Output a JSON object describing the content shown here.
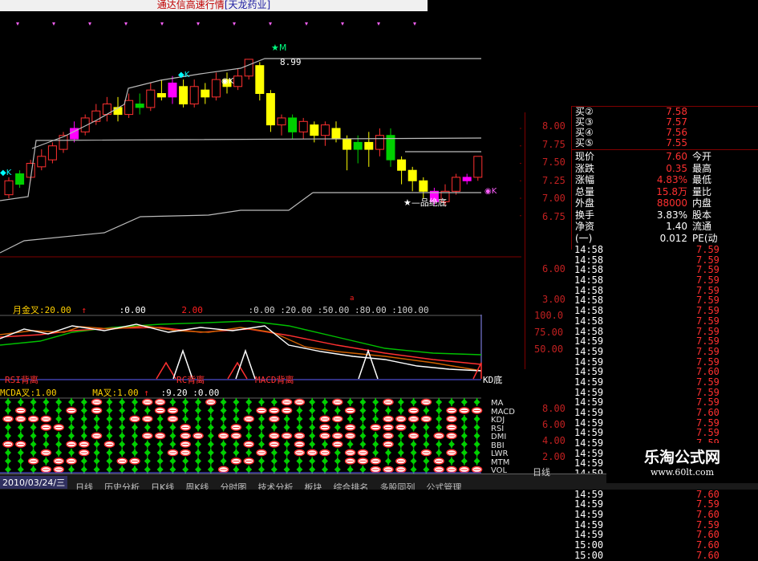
{
  "title": {
    "text": "通达信高速行情",
    "tag": "[天龙药业]"
  },
  "price_axis": {
    "ticks": [
      "8.00",
      "7.75",
      "7.50",
      "7.25",
      "7.00",
      "6.75"
    ]
  },
  "vol_axis": {
    "ticks": [
      "6.00",
      "3.00"
    ]
  },
  "kdj_axis": {
    "ticks": [
      "100.0",
      "75.00",
      "50.00"
    ]
  },
  "sig_axis": {
    "ticks": [
      "8.00",
      "6.00",
      "4.00",
      "2.00"
    ]
  },
  "chart_labels": {
    "high": "8.99",
    "m_marker": "M",
    "k_marker": "K",
    "k_marker2": "K",
    "bottom_text": "品绝底"
  },
  "kdj_header": {
    "indicator": "月金叉:20.00",
    "v1": ":0.00",
    "v2": "2.00",
    "v3": ":0.00 :20.00 :50.00 :80.00 :100.00",
    "mark": "a"
  },
  "sig_header": {
    "left": "MCDA叉:1.00",
    "mid": "MA叉:1.00",
    "right": ":9.20 :0.00"
  },
  "sig_small_labels": {
    "rsi": "RSI背离",
    "rc": "RC背离",
    "macd": "MACD背离",
    "kd": "KD底"
  },
  "indicators": [
    "MA",
    "MACD",
    "KDJ",
    "RSI",
    "DMI",
    "BBI",
    "LWR",
    "MTM",
    "VOL"
  ],
  "quote": {
    "top_rows": [
      {
        "label": "买②",
        "value": "7.58"
      },
      {
        "label": "买③",
        "value": "7.57"
      },
      {
        "label": "买④",
        "value": "7.56"
      },
      {
        "label": "买⑤",
        "value": "7.55"
      }
    ],
    "stats": [
      {
        "label": "现价",
        "value": "7.60",
        "right": "今开"
      },
      {
        "label": "涨跌",
        "value": "0.35",
        "right": "最高"
      },
      {
        "label": "涨幅",
        "value": "4.83%",
        "right": "最低"
      },
      {
        "label": "总量",
        "value": "15.8万",
        "right": "量比"
      },
      {
        "label": "外盘",
        "value": "88000",
        "right": "内盘"
      },
      {
        "label": "换手",
        "value": "3.83%",
        "right": "股本"
      },
      {
        "label": "净资",
        "value": "1.40",
        "right": "流通"
      },
      {
        "label": "(一)",
        "value": "0.012",
        "right": "PE(动"
      }
    ],
    "ticks": [
      {
        "time": "14:58",
        "price": "7.59"
      },
      {
        "time": "14:58",
        "price": "7.59"
      },
      {
        "time": "14:58",
        "price": "7.59"
      },
      {
        "time": "14:58",
        "price": "7.59"
      },
      {
        "time": "14:58",
        "price": "7.59"
      },
      {
        "time": "14:58",
        "price": "7.59"
      },
      {
        "time": "14:58",
        "price": "7.59"
      },
      {
        "time": "14:58",
        "price": "7.59"
      },
      {
        "time": "14:58",
        "price": "7.59"
      },
      {
        "time": "14:59",
        "price": "7.59"
      },
      {
        "time": "14:59",
        "price": "7.59"
      },
      {
        "time": "14:59",
        "price": "7.59"
      },
      {
        "time": "14:59",
        "price": "7.60"
      },
      {
        "time": "14:59",
        "price": "7.59"
      },
      {
        "time": "14:59",
        "price": "7.59"
      },
      {
        "time": "14:59",
        "price": "7.59"
      },
      {
        "time": "14:59",
        "price": "7.60"
      },
      {
        "time": "14:59",
        "price": "7.59"
      },
      {
        "time": "14:59",
        "price": "7.59"
      },
      {
        "time": "14:59",
        "price": "7.59"
      },
      {
        "time": "14:59",
        "price": "7.59"
      },
      {
        "time": "14:59",
        "price": "7.59"
      },
      {
        "time": "14:59",
        "price": "7.59"
      },
      {
        "time": "14:59",
        "price": "7.60"
      },
      {
        "time": "14:59",
        "price": "7.60"
      },
      {
        "time": "14:59",
        "price": "7.59"
      },
      {
        "time": "14:59",
        "price": "7.60"
      },
      {
        "time": "14:59",
        "price": "7.59"
      },
      {
        "time": "14:59",
        "price": "7.60"
      },
      {
        "time": "15:00",
        "price": "7.60"
      },
      {
        "time": "15:00",
        "price": "7.60"
      }
    ]
  },
  "footer": {
    "date": "2010/03/24/三",
    "period": "日线",
    "tabs": [
      "日线",
      "历史分析",
      "日K线",
      "周K线",
      "分时图",
      "技术分析",
      "板块",
      "综合排名",
      "多股同列",
      "公式管理"
    ]
  },
  "watermark": {
    "title": "乐淘公式网",
    "url": "www.60lt.com"
  },
  "colors": {
    "up": "#ff3333",
    "down": "#54ffff",
    "grid": "#800000",
    "yellow": "#ffff00",
    "magenta": "#ff00ff",
    "green_signal": "#00e000"
  }
}
